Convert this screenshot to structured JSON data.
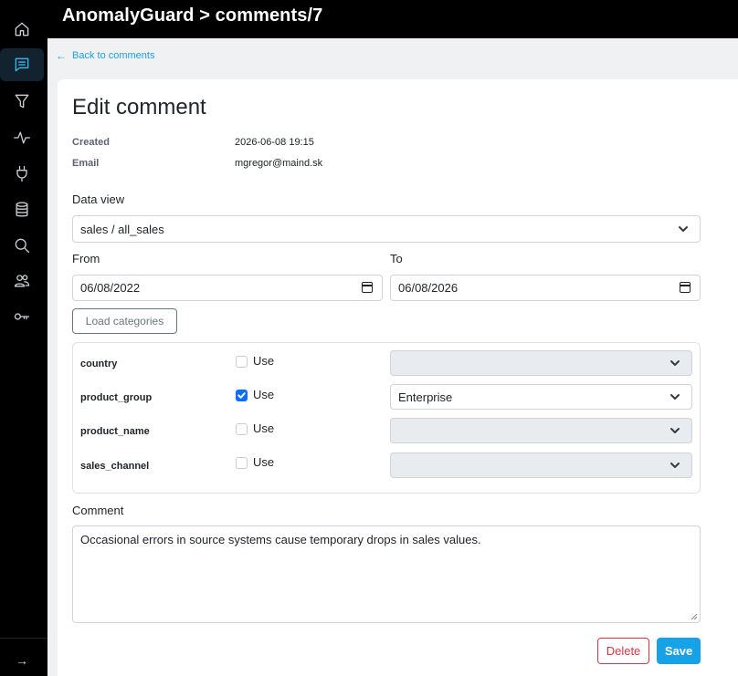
{
  "header": {
    "title": "AnomalyGuard > comments/7"
  },
  "sidebar": {
    "items": [
      {
        "icon": "home-icon",
        "label": "Home"
      },
      {
        "icon": "comments-icon",
        "label": "Comments",
        "active": true
      },
      {
        "icon": "filter-icon",
        "label": "Filters"
      },
      {
        "icon": "activity-icon",
        "label": "Activity"
      },
      {
        "icon": "plug-icon",
        "label": "Connections"
      },
      {
        "icon": "database-icon",
        "label": "Data"
      },
      {
        "icon": "search-icon",
        "label": "Search"
      },
      {
        "icon": "users-icon",
        "label": "Users"
      },
      {
        "icon": "key-icon",
        "label": "Keys"
      }
    ],
    "expand_icon": "→"
  },
  "back_link": {
    "label": "Back to comments",
    "arrow": "←"
  },
  "form": {
    "title": "Edit comment",
    "created_label": "Created",
    "created_value": "2026-06-08 19:15",
    "email_label": "Email",
    "email_value": "mgregor@maind.sk",
    "data_view_label": "Data view",
    "data_view_value": "sales / all_sales",
    "from_label": "From",
    "from_value": "06/08/2022",
    "to_label": "To",
    "to_value": "06/08/2026",
    "load_categories_label": "Load categories",
    "categories": [
      {
        "name": "country",
        "use_label": "Use",
        "checked": false,
        "value": ""
      },
      {
        "name": "product_group",
        "use_label": "Use",
        "checked": true,
        "value": "Enterprise"
      },
      {
        "name": "product_name",
        "use_label": "Use",
        "checked": false,
        "value": ""
      },
      {
        "name": "sales_channel",
        "use_label": "Use",
        "checked": false,
        "value": ""
      }
    ],
    "comment_label": "Comment",
    "comment_value": "Occasional errors in source systems cause temporary drops in sales values.",
    "delete_label": "Delete",
    "save_label": "Save"
  },
  "colors": {
    "accent": "#17a2e8",
    "danger": "#dc3545",
    "checkbox": "#0d6efd",
    "sidebar_bg": "#000000",
    "active_icon": "#31b8f0"
  }
}
